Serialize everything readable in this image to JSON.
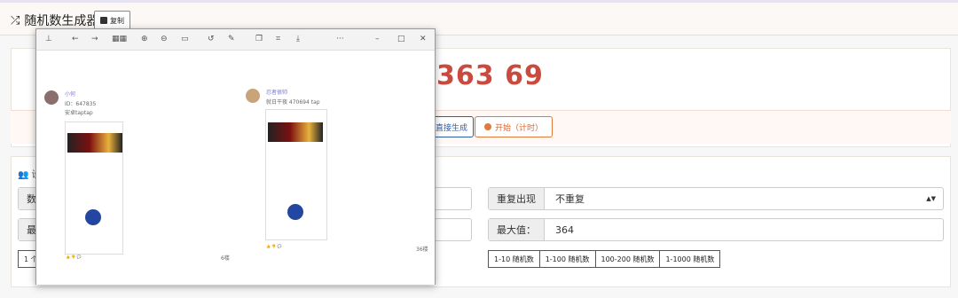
{
  "header": {
    "title": "随机数生成器",
    "copy_label": "复制"
  },
  "result": {
    "text": "363 69"
  },
  "buttons": {
    "direct": "直接生成",
    "start": "开始（计时）"
  },
  "settings": {
    "title": "设",
    "count_label": "数",
    "min_label": "最",
    "repeat_label": "重复出现",
    "repeat_value": "不重复",
    "max_label": "最大值：",
    "max_value": "364",
    "left_preset": "1 个",
    "presets": [
      "1-10 随机数",
      "1-100 随机数",
      "100-200 随机数",
      "1-1000 随机数"
    ]
  },
  "viewer": {
    "post1": {
      "name": "小何",
      "id": "ID：647835",
      "subtitle": "安卓taptap",
      "footer": "6楼"
    },
    "post2": {
      "name": "忍者很帅",
      "meta": "就日干夜 470694 tap",
      "footer": "36楼"
    }
  }
}
